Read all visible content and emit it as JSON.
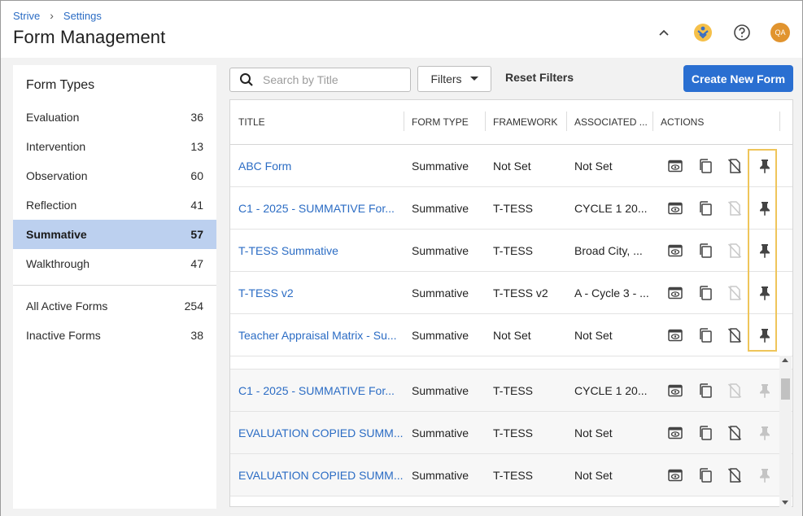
{
  "breadcrumb": {
    "root": "Strive",
    "current": "Settings"
  },
  "page": {
    "title": "Form Management"
  },
  "header_icons": {
    "collapse": "chevron-up-icon",
    "app": "strive-logo-icon",
    "help": "help-circle-icon",
    "avatar_initials": "QA",
    "avatar_color": "#e1942f"
  },
  "sidebar": {
    "heading": "Form Types",
    "types": [
      {
        "label": "Evaluation",
        "count": "36",
        "active": false
      },
      {
        "label": "Intervention",
        "count": "13",
        "active": false
      },
      {
        "label": "Observation",
        "count": "60",
        "active": false
      },
      {
        "label": "Reflection",
        "count": "41",
        "active": false
      },
      {
        "label": "Summative",
        "count": "57",
        "active": true
      },
      {
        "label": "Walkthrough",
        "count": "47",
        "active": false
      }
    ],
    "status": [
      {
        "label": "All Active Forms",
        "count": "254"
      },
      {
        "label": "Inactive Forms",
        "count": "38"
      }
    ]
  },
  "toolbar": {
    "search_placeholder": "Search by Title",
    "search_value": "",
    "filters_label": "Filters",
    "reset_label": "Reset Filters",
    "create_label": "Create New Form"
  },
  "table": {
    "columns": [
      "TITLE",
      "FORM TYPE",
      "FRAMEWORK",
      "ASSOCIATED ...",
      "ACTIONS"
    ],
    "pinned_rows": [
      {
        "title": "ABC Form",
        "type": "Summative",
        "framework": "Not Set",
        "associated": "Not Set",
        "deactivate_enabled": true
      },
      {
        "title": "C1 - 2025 - SUMMATIVE For...",
        "type": "Summative",
        "framework": "T-TESS",
        "associated": "CYCLE 1 20...",
        "deactivate_enabled": false
      },
      {
        "title": "T-TESS Summative",
        "type": "Summative",
        "framework": "T-TESS",
        "associated": "Broad City, ...",
        "deactivate_enabled": false
      },
      {
        "title": "T-TESS v2",
        "type": "Summative",
        "framework": "T-TESS v2",
        "associated": "A - Cycle 3 - ...",
        "deactivate_enabled": false
      },
      {
        "title": "Teacher Appraisal Matrix - Su...",
        "type": "Summative",
        "framework": "Not Set",
        "associated": "Not Set",
        "deactivate_enabled": true
      }
    ],
    "rows": [
      {
        "title": "C1 - 2025 - SUMMATIVE For...",
        "type": "Summative",
        "framework": "T-TESS",
        "associated": "CYCLE 1 20...",
        "deactivate_enabled": false
      },
      {
        "title": "EVALUATION COPIED SUMM...",
        "type": "Summative",
        "framework": "T-TESS",
        "associated": "Not Set",
        "deactivate_enabled": true
      },
      {
        "title": "EVALUATION COPIED SUMM...",
        "type": "Summative",
        "framework": "T-TESS",
        "associated": "Not Set",
        "deactivate_enabled": true
      }
    ]
  },
  "colors": {
    "accent": "#2a6fd1",
    "link": "#2b6cc4",
    "active_bg": "#bcd0ef",
    "highlight": "#efc55a"
  }
}
